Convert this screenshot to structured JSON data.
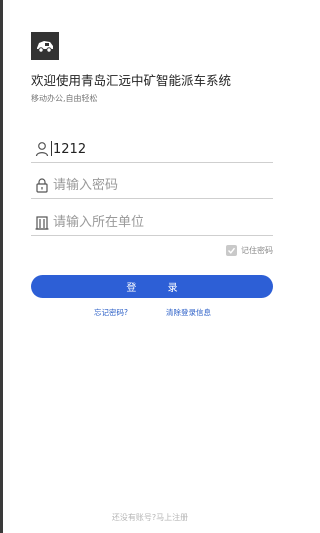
{
  "header": {
    "title": "欢迎使用青岛汇远中矿智能派车系统",
    "subtitle": "移动办公,自由轻松"
  },
  "form": {
    "username": {
      "value": "1212",
      "placeholder": ""
    },
    "password": {
      "value": "",
      "placeholder": "请输入密码"
    },
    "company": {
      "value": "",
      "placeholder": "请输入所在单位"
    },
    "remember_label": "记住密码",
    "remember_checked": true
  },
  "buttons": {
    "login_label": "登 录"
  },
  "links": {
    "forgot": "忘记密码?",
    "clear": "清除登录信息",
    "register": "还没有账号?马上注册"
  },
  "colors": {
    "primary": "#2d5fd6",
    "link": "#2b5fc7",
    "logo_bg": "#333333"
  },
  "icons": [
    "truck-icon",
    "user-icon",
    "lock-icon",
    "building-icon",
    "check-icon"
  ]
}
